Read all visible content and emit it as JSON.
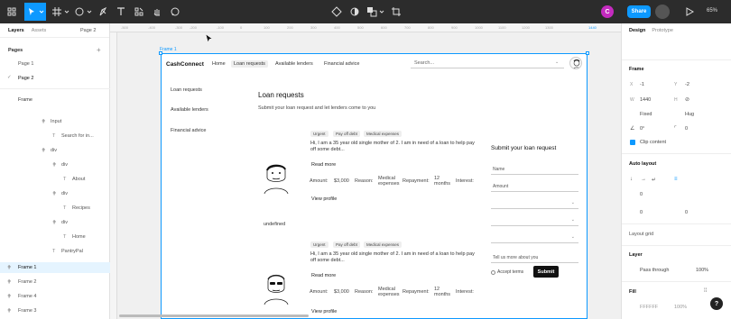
{
  "toolbar": {
    "user_initial": "C",
    "share_label": "Share",
    "zoom": "65%"
  },
  "left_panel": {
    "tabs": [
      "Layers",
      "Assets"
    ],
    "page_selector": "Page 2",
    "pages_heading": "Pages",
    "pages": [
      "Page 1",
      "Page 2"
    ],
    "frame_heading": "Frame",
    "layers": [
      {
        "label": "Input"
      },
      {
        "label": "Search for in..."
      },
      {
        "label": "div"
      },
      {
        "label": "div"
      },
      {
        "label": "About"
      },
      {
        "label": "div"
      },
      {
        "label": "Recipes"
      },
      {
        "label": "div"
      },
      {
        "label": "Home"
      },
      {
        "label": "PantryPal"
      }
    ],
    "frames": [
      "Frame 1",
      "Frame 2",
      "Frame 4",
      "Frame 3"
    ]
  },
  "canvas": {
    "ruler_ticks": [
      "-500",
      "-400",
      "-300",
      "-200",
      "-100",
      "0",
      "100",
      "200",
      "300",
      "400",
      "500",
      "600",
      "700",
      "800",
      "900",
      "1000",
      "1100",
      "1200",
      "1300",
      "1440"
    ],
    "frame_label": "Frame 1"
  },
  "app": {
    "brand": "CashConnect",
    "nav": [
      "Home",
      "Loan requests",
      "Available lenders",
      "Financial advice"
    ],
    "search_placeholder": "Search...",
    "side_nav": [
      "Loan requests",
      "Available lenders",
      "Financial advice"
    ],
    "title": "Loan requests",
    "subtitle": "Submit your loan request and let lenders come to you",
    "cards": [
      {
        "tags": [
          "Urgent",
          "Pay off debt",
          "Medical expenses"
        ],
        "text": "Hi, I am a 35 year old single mother of 2. I am in need of a loan to help pay off some debt...",
        "read_more": "Read more",
        "amount_label": "Amount:",
        "amount": "$3,000",
        "reason_label": "Reason:",
        "reason": "Medical expenses",
        "repayment_label": "Repayment:",
        "repayment": "12 months",
        "interest_label": "Interest:",
        "view_profile": "View profile"
      },
      {
        "tags": [
          "Urgent",
          "Pay off debt",
          "Medical expenses"
        ],
        "text": "Hi, I am a 35 year old single mother of 2. I am in need of a loan to help pay off some debt...",
        "read_more": "Read more",
        "amount_label": "Amount:",
        "amount": "$3,000",
        "reason_label": "Reason:",
        "reason": "Medical expenses",
        "repayment_label": "Repayment:",
        "repayment": "12 months",
        "interest_label": "Interest:",
        "view_profile": "View profile"
      }
    ],
    "undefined_text": "undefined",
    "form": {
      "title": "Submit your loan request",
      "name_placeholder": "Name",
      "amount_placeholder": "Amount",
      "tell_us": "Tell us more about you",
      "accept_terms": "Accept terms",
      "submit": "Submit"
    }
  },
  "right_panel": {
    "tabs": [
      "Design",
      "Prototype"
    ],
    "frame_heading": "Frame",
    "x_label": "X",
    "x_value": "-1",
    "y_label": "Y",
    "y_value": "-2",
    "w_label": "W",
    "w_value": "1440",
    "h_label": "H",
    "w_mode": "Fixed",
    "h_mode": "Hug",
    "rotation": "0°",
    "radius": "0",
    "clip_content": "Clip content",
    "auto_layout_heading": "Auto layout",
    "gap_value": "0",
    "padding_value": "0",
    "pad_v1": "0",
    "pad_v2": "0",
    "layout_grid_heading": "Layout grid",
    "layer_heading": "Layer",
    "pass_through": "Pass through",
    "opacity": "100%",
    "fill_heading": "Fill",
    "fill_hex": "FFFFFF",
    "fill_opacity": "100%"
  },
  "colors": {
    "accent": "#0d99ff",
    "toolbar_bg": "#2c2c2c",
    "avatar": "#c42bbf"
  }
}
